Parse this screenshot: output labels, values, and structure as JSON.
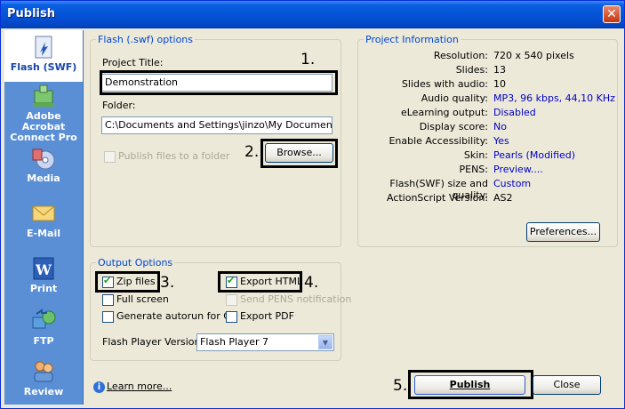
{
  "window": {
    "title": "Publish",
    "close_glyph": "✕"
  },
  "sidebar": {
    "items": [
      {
        "label": "Flash (SWF)",
        "icon": "flash-icon",
        "active": true
      },
      {
        "label": "Adobe Acrobat Connect Pro",
        "icon": "connect-icon"
      },
      {
        "label": "Media",
        "icon": "media-icon"
      },
      {
        "label": "E-Mail",
        "icon": "email-icon"
      },
      {
        "label": "Print",
        "icon": "print-icon"
      },
      {
        "label": "FTP",
        "icon": "ftp-icon"
      },
      {
        "label": "Review",
        "icon": "review-icon"
      }
    ]
  },
  "flash_options": {
    "legend": "Flash (.swf) options",
    "project_title_label": "Project Title:",
    "project_title_value": "Demonstration",
    "folder_label": "Folder:",
    "folder_value": "C:\\Documents and Settings\\jinzo\\My Documents\\My",
    "browse_label": "Browse...",
    "publish_folder_label": "Publish files to a folder"
  },
  "project_info": {
    "legend": "Project Information",
    "rows": [
      {
        "key": "Resolution:",
        "value": "720 x 540 pixels",
        "plain": true
      },
      {
        "key": "Slides:",
        "value": "13",
        "plain": true
      },
      {
        "key": "Slides with audio:",
        "value": "10",
        "plain": true
      },
      {
        "key": "Audio quality:",
        "value": "MP3, 96 kbps, 44,10 KHz"
      },
      {
        "key": "eLearning output:",
        "value": "Disabled"
      },
      {
        "key": "Display score:",
        "value": "No"
      },
      {
        "key": "Enable Accessibility:",
        "value": "Yes"
      },
      {
        "key": "Skin:",
        "value": "Pearls (Modified)"
      },
      {
        "key": "PENS:",
        "value": "Preview...."
      },
      {
        "key": "Flash(SWF) size and quality:",
        "value": "Custom"
      },
      {
        "key": "ActionScript Version:",
        "value": "AS2",
        "plain": true
      }
    ],
    "preferences_label": "Preferences..."
  },
  "output_options": {
    "legend": "Output Options",
    "zip_files": "Zip files",
    "full_screen": "Full screen",
    "autorun": "Generate autorun for CD",
    "export_html": "Export HTML",
    "send_pens": "Send PENS notification",
    "export_pdf": "Export PDF",
    "player_label": "Flash Player Version:",
    "player_value": "Flash Player 7"
  },
  "callouts": {
    "n1": "1.",
    "n2": "2.",
    "n3": "3.",
    "n4": "4.",
    "n5": "5."
  },
  "footer": {
    "learn_more": "Learn more...",
    "publish_label": "Publish",
    "close_label": "Close"
  }
}
